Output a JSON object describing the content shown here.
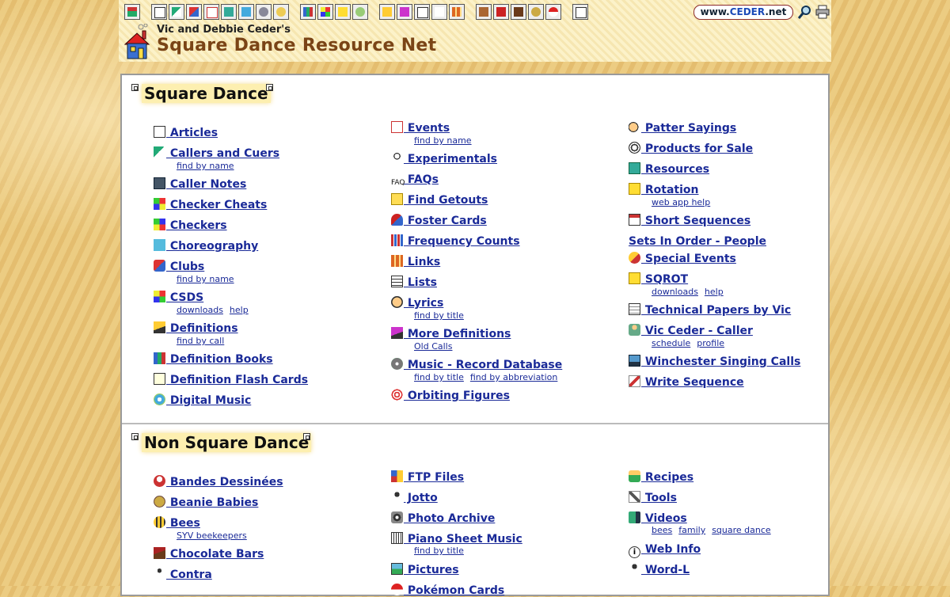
{
  "header": {
    "byline": "Vic and Debbie Ceder's",
    "title": "Square Dance Resource Net",
    "badge": "www.CEDER.net",
    "badge_split": [
      "www.",
      "CEDER",
      ".net"
    ]
  },
  "sections": {
    "square": {
      "title": "Square Dance"
    },
    "nonsquare": {
      "title": "Non Square Dance"
    }
  },
  "sq": {
    "articles": "Articles",
    "callers": "Callers and Cuers",
    "callers_sub": "find by name",
    "caller_notes": "Caller Notes",
    "checker_cheats": "Checker Cheats",
    "checkers": "Checkers",
    "choreography": "Choreography",
    "clubs": "Clubs",
    "clubs_sub": "find by name",
    "csds": "CSDS",
    "csds_sub1": "downloads",
    "csds_sub2": "help",
    "definitions": "Definitions",
    "definitions_sub": "find by call",
    "definition_books": "Definition Books",
    "flash_cards": "Definition Flash Cards",
    "digital_music": "Digital Music",
    "events": "Events",
    "events_sub": "find by name",
    "experimentals": "Experimentals",
    "faqs": "FAQs",
    "find_getouts": "Find Getouts",
    "foster_cards": "Foster Cards",
    "frequency_counts": "Frequency Counts",
    "links": "Links",
    "lists": "Lists",
    "lyrics": "Lyrics",
    "lyrics_sub": "find by title",
    "more_definitions": "More Definitions",
    "more_definitions_sub": "Old Calls",
    "music_db": "Music - Record Database",
    "music_sub1": "find by title",
    "music_sub2": "find by abbreviation",
    "orbiting": "Orbiting Figures",
    "patter": "Patter Sayings",
    "products": "Products for Sale",
    "resources": "Resources",
    "rotation": "Rotation",
    "rotation_sub": "web app help",
    "short_sequences": "Short Sequences",
    "sets_in_order": "Sets In Order - People",
    "special_events": "Special Events",
    "sqrot": "SQROT",
    "sqrot_sub1": "downloads",
    "sqrot_sub2": "help",
    "tech_papers": "Technical Papers by Vic",
    "vic_caller": "Vic Ceder - Caller",
    "vic_sub1": "schedule",
    "vic_sub2": "profile",
    "winchester": "Winchester Singing Calls",
    "write_sequence": "Write Sequence"
  },
  "nsq": {
    "bandes": "Bandes Dessinées",
    "beanie": "Beanie Babies",
    "bees": "Bees",
    "bees_sub": "SYV beekeepers",
    "chocolate": "Chocolate Bars",
    "contra": "Contra",
    "ftp": "FTP Files",
    "jotto": "Jotto",
    "photo_archive": "Photo Archive",
    "piano": "Piano Sheet Music",
    "piano_sub": "find by title",
    "pictures": "Pictures",
    "pokemon": "Pokémon Cards",
    "recipes": "Recipes",
    "tools": "Tools",
    "videos": "Videos",
    "videos_sub1": "bees",
    "videos_sub2": "family",
    "videos_sub3": "square dance",
    "web_info": "Web Info",
    "wordl": "Word-L"
  },
  "icons": {
    "toolbar": [
      "home-icon",
      "articles-icon",
      "callers-icon",
      "clubs-icon",
      "events-icon",
      "resources-icon",
      "choreography-icon",
      "music-icon",
      "lyrics-icon",
      "definition-books-icon",
      "csds-icon",
      "sqrot-icon",
      "vic-icon",
      "definitions-icon",
      "more-definitions-icon",
      "lists-icon",
      "faqs-icon",
      "links-icon",
      "bees-icon",
      "foster-icon",
      "chocolate-icon",
      "beanie-icon",
      "pokemon-icon",
      "write-icon"
    ]
  },
  "colors": {
    "link": "#1a2a98",
    "title_brown": "#7a4416",
    "section_bg": "#fdefb0"
  }
}
